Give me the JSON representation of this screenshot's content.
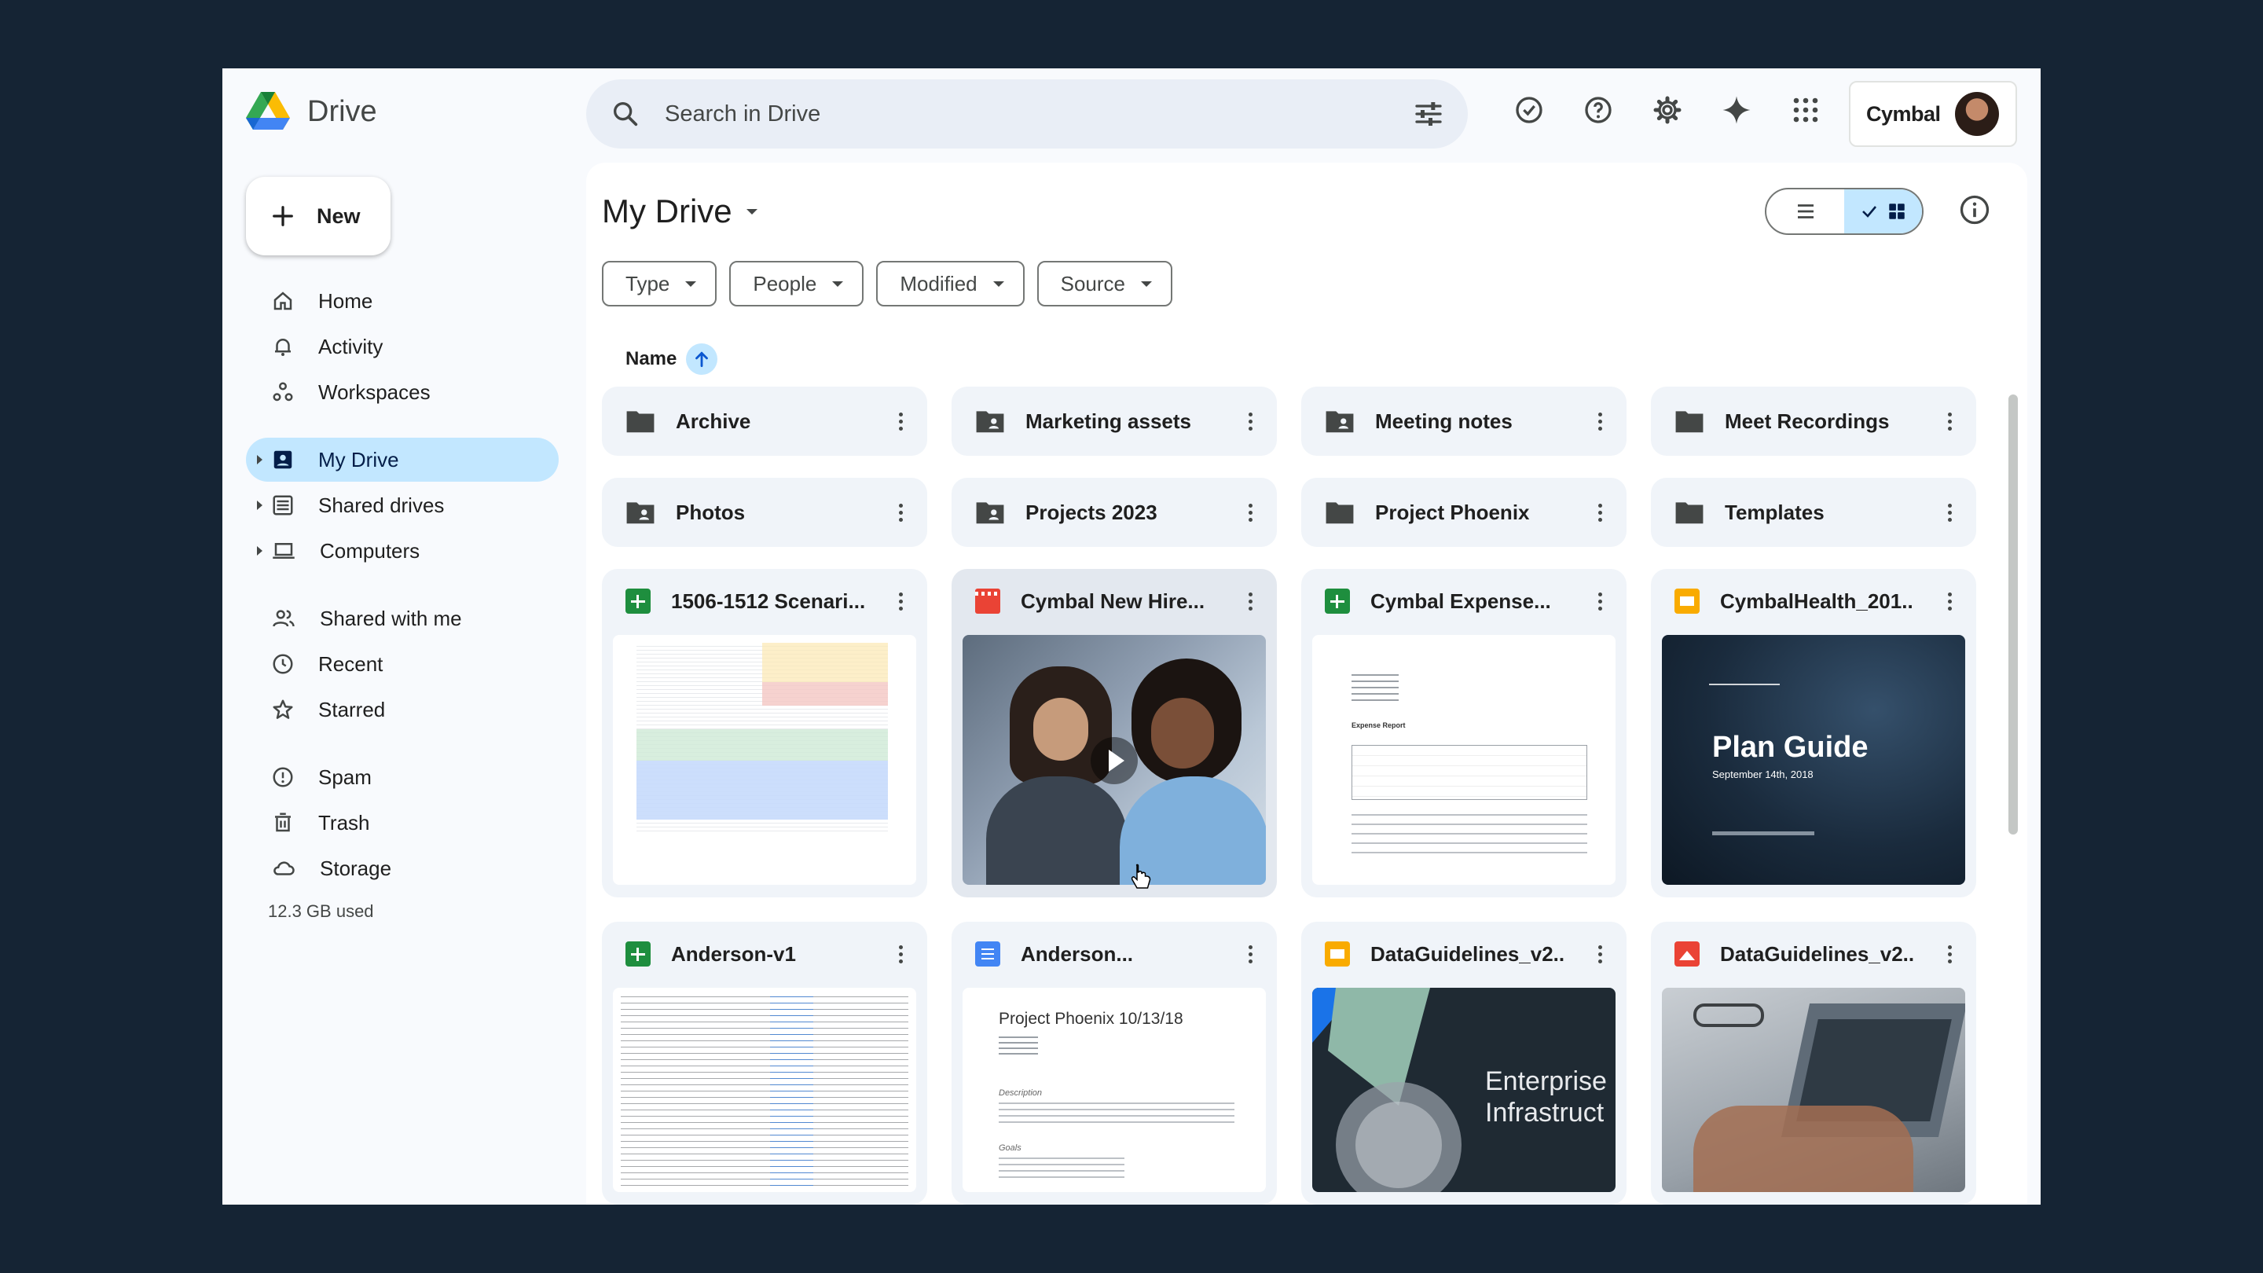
{
  "app": {
    "title": "Drive"
  },
  "search": {
    "placeholder": "Search in Drive"
  },
  "account": {
    "brand": "Cymbal"
  },
  "sidebar": {
    "new_label": "New",
    "items": [
      {
        "label": "Home",
        "icon": "home-icon"
      },
      {
        "label": "Activity",
        "icon": "bell-icon"
      },
      {
        "label": "Workspaces",
        "icon": "workspaces-icon"
      },
      {
        "label": "My Drive",
        "icon": "my-drive-icon",
        "active": true
      },
      {
        "label": "Shared drives",
        "icon": "shared-drives-icon"
      },
      {
        "label": "Computers",
        "icon": "computer-icon"
      },
      {
        "label": "Shared with me",
        "icon": "people-icon"
      },
      {
        "label": "Recent",
        "icon": "clock-icon"
      },
      {
        "label": "Starred",
        "icon": "star-icon"
      },
      {
        "label": "Spam",
        "icon": "spam-icon"
      },
      {
        "label": "Trash",
        "icon": "trash-icon"
      },
      {
        "label": "Storage",
        "icon": "cloud-icon"
      }
    ],
    "storage_used": "12.3 GB used"
  },
  "main": {
    "title": "My Drive",
    "filters": [
      "Type",
      "People",
      "Modified",
      "Source"
    ],
    "sort_label": "Name",
    "folders": [
      {
        "name": "Archive",
        "shared": false
      },
      {
        "name": "Marketing assets",
        "shared": true
      },
      {
        "name": "Meeting notes",
        "shared": true
      },
      {
        "name": "Meet Recordings",
        "shared": false
      },
      {
        "name": "Photos",
        "shared": true
      },
      {
        "name": "Projects 2023",
        "shared": true
      },
      {
        "name": "Project Phoenix",
        "shared": false
      },
      {
        "name": "Templates",
        "shared": false
      }
    ],
    "files": [
      {
        "name": "1506-1512 Scenari...",
        "type": "sheet"
      },
      {
        "name": "Cymbal New Hire...",
        "type": "video"
      },
      {
        "name": "Cymbal Expense...",
        "type": "sheet"
      },
      {
        "name": "CymbalHealth_201...",
        "type": "slide"
      },
      {
        "name": "Anderson-v1",
        "type": "sheet"
      },
      {
        "name": "Anderson...",
        "type": "doc"
      },
      {
        "name": "DataGuidelines_v2...",
        "type": "slide"
      },
      {
        "name": "DataGuidelines_v2...",
        "type": "image"
      }
    ],
    "thumbs": {
      "plan_guide_title": "Plan Guide",
      "plan_guide_date": "September 14th, 2018",
      "doc_title": "Project Phoenix 10/13/18",
      "doc_section_1": "Description",
      "doc_section_2": "Goals",
      "enterprise_line1": "Enterprise",
      "enterprise_line2": "Infrastruct",
      "expense_title": "Expense Report"
    }
  }
}
